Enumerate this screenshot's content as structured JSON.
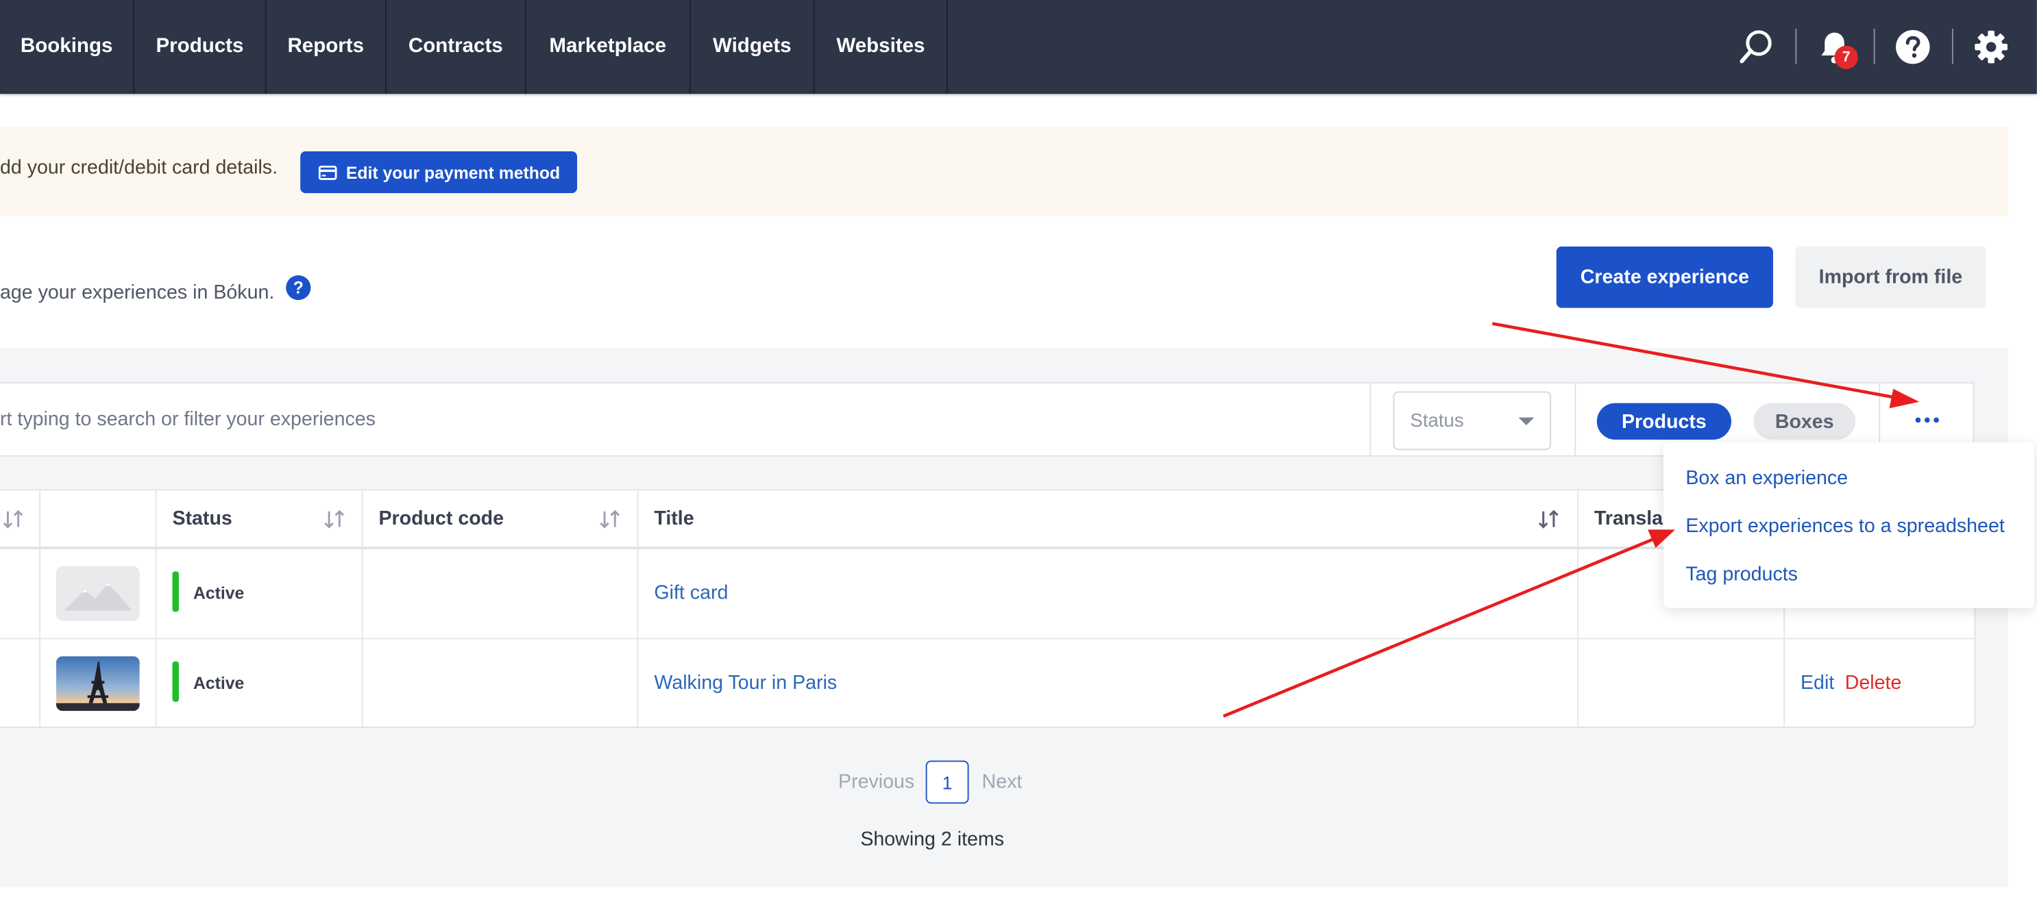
{
  "nav": {
    "items": [
      "Bookings",
      "Products",
      "Reports",
      "Contracts",
      "Marketplace",
      "Widgets",
      "Websites"
    ],
    "notification_count": "7",
    "icons": [
      "search-icon",
      "bell-icon",
      "help-icon",
      "gear-icon"
    ]
  },
  "banner": {
    "text": "dd your credit/debit card details.",
    "button_label": "Edit your payment method"
  },
  "header": {
    "description": "age your experiences in Bókun.",
    "help_glyph": "?",
    "create_button": "Create experience",
    "import_button": "Import from file"
  },
  "search": {
    "placeholder": "rt typing to search or filter your experiences",
    "status_placeholder": "Status"
  },
  "view_toggle": {
    "products": "Products",
    "boxes": "Boxes"
  },
  "table": {
    "columns": [
      "Status",
      "Product code",
      "Title",
      "Transla"
    ],
    "rows": [
      {
        "status": "Active",
        "product_code": "",
        "title": "Gift card",
        "actions": []
      },
      {
        "status": "Active",
        "product_code": "",
        "title": "Walking Tour in Paris",
        "actions": [
          "Edit",
          "Delete"
        ]
      }
    ]
  },
  "pagination": {
    "previous": "Previous",
    "current": "1",
    "next": "Next",
    "showing": "Showing 2 items"
  },
  "more_menu": {
    "items": [
      "Box an experience",
      "Export experiences to a spreadsheet",
      "Tag products"
    ]
  },
  "colors": {
    "nav_bg": "#2e3547",
    "primary": "#1b52c9",
    "status_active": "#1fbf2a",
    "link": "#2a67b8",
    "danger": "#e3292b",
    "annotation_arrow": "#e81e1e",
    "banner_bg": "#fdf8ef"
  }
}
